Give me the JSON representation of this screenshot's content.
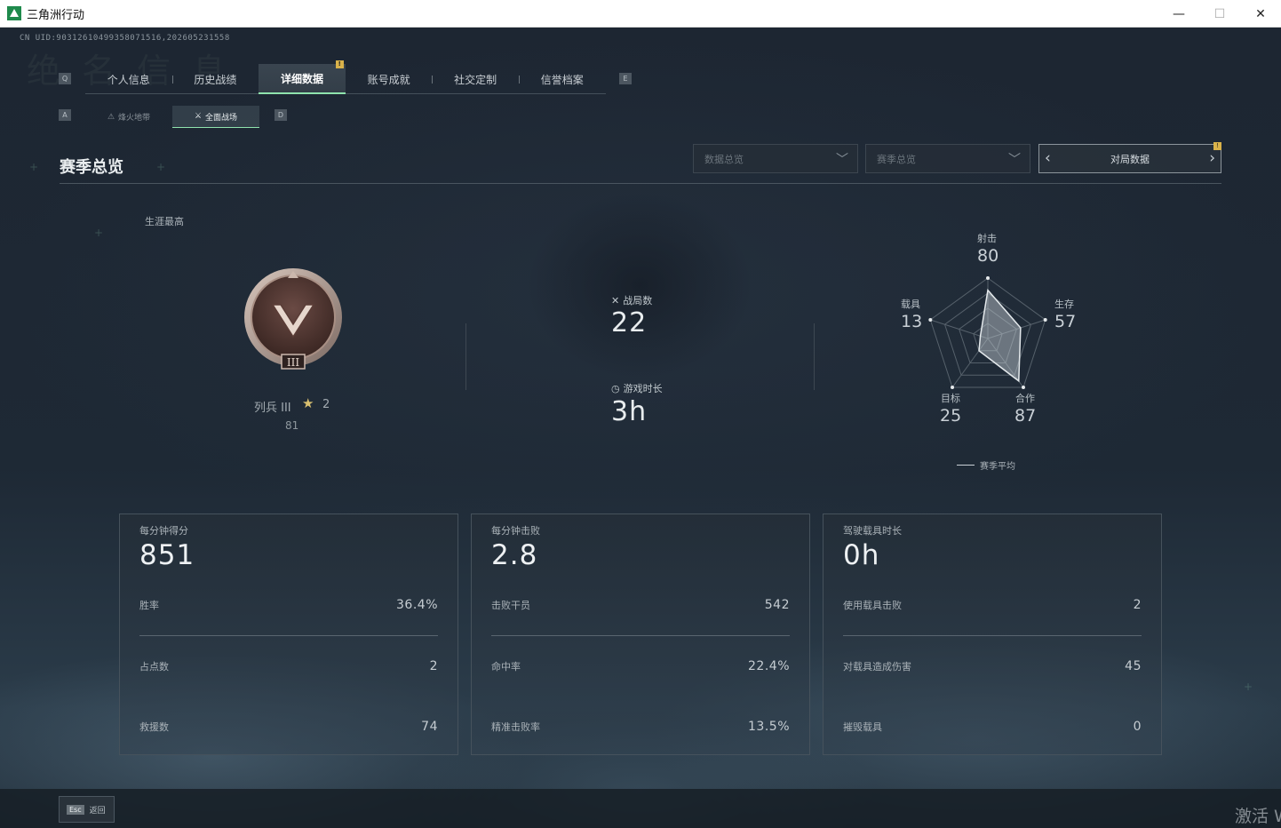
{
  "window": {
    "title": "三角洲行动",
    "minimize": "—",
    "maximize": "☐",
    "close": "✕"
  },
  "header": {
    "uid": "CN UID:9031261049935807151​6,202605231558",
    "watermark": "绝 名 信 息"
  },
  "keyhints": {
    "tab_prev": "Q",
    "tab_next": "E",
    "sub_prev": "A",
    "sub_next": "D"
  },
  "tabs": [
    {
      "label": "个人信息"
    },
    {
      "label": "历史战绩"
    },
    {
      "label": "详细数据",
      "badge": "!"
    },
    {
      "label": "账号成就"
    },
    {
      "label": "社交定制"
    },
    {
      "label": "信誉档案"
    }
  ],
  "subtabs": [
    {
      "label": "烽火地带",
      "icon": "⚠"
    },
    {
      "label": "全面战场",
      "icon": "⚔"
    }
  ],
  "section": {
    "title": "赛季总览",
    "dropdown_data": "数据总览",
    "dropdown_season": "赛季总览",
    "match_nav": "对局数据",
    "match_badge": "!"
  },
  "rank": {
    "career_label": "生涯最高",
    "name": "列兵 III",
    "stars": "2",
    "points": "81",
    "medal_numeral": "III"
  },
  "summary": {
    "matches_label": "战局数",
    "matches_value": "22",
    "playtime_label": "游戏时长",
    "playtime_value": "3h"
  },
  "radar": {
    "axes": [
      {
        "label": "射击",
        "value": "80",
        "level": 0.8
      },
      {
        "label": "生存",
        "value": "57",
        "level": 0.57
      },
      {
        "label": "合作",
        "value": "87",
        "level": 0.87
      },
      {
        "label": "目标",
        "value": "25",
        "level": 0.25
      },
      {
        "label": "载具",
        "value": "13",
        "level": 0.13
      }
    ],
    "legend": "赛季平均"
  },
  "cards": [
    {
      "title": "每分钟得分",
      "value": "851",
      "rows": [
        {
          "label": "胜率",
          "value": "36.4%"
        },
        {
          "label": "占点数",
          "value": "2"
        },
        {
          "label": "救援数",
          "value": "74"
        }
      ]
    },
    {
      "title": "每分钟击败",
      "value": "2.8",
      "rows": [
        {
          "label": "击败干员",
          "value": "542"
        },
        {
          "label": "命中率",
          "value": "22.4%"
        },
        {
          "label": "精准击败率",
          "value": "13.5%"
        }
      ]
    },
    {
      "title": "驾驶载具时长",
      "value": "0h",
      "rows": [
        {
          "label": "使用载具击败",
          "value": "2"
        },
        {
          "label": "对载具造成伤害",
          "value": "45"
        },
        {
          "label": "摧毁载具",
          "value": "0"
        }
      ]
    }
  ],
  "footer": {
    "esc_key": "Esc",
    "esc_label": "返回",
    "activate_text": "激活 W"
  },
  "colors": {
    "accent_green": "#8fe3ad",
    "badge_yellow": "#d9b24a",
    "background": "#1d2632"
  }
}
